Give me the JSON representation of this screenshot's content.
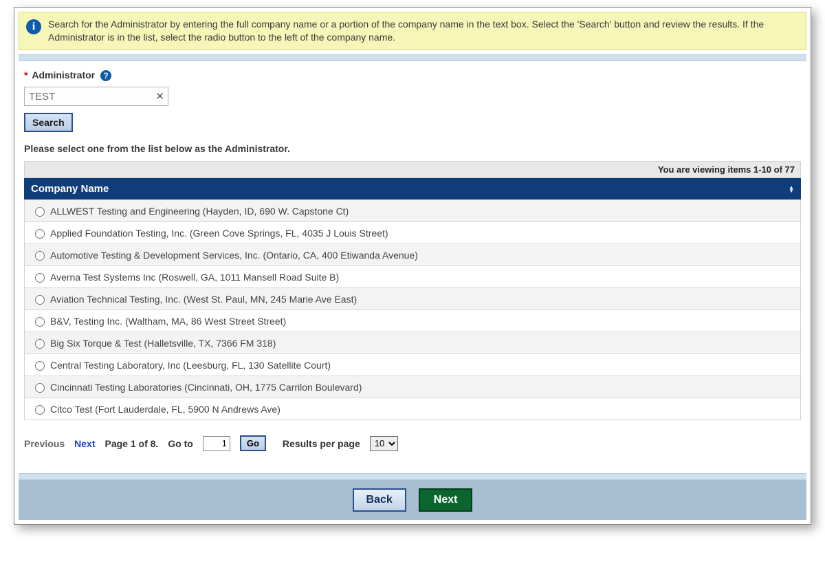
{
  "banner": {
    "text": "Search for the Administrator by entering the full company name or a portion of the company name in the text box. Select the 'Search' button and review the results. If the Administrator is in the list, select the radio button to the left of the company name."
  },
  "field": {
    "label": "Administrator",
    "value": "TEST",
    "search_label": "Search"
  },
  "instruction": "Please select one from the list below as the Administrator.",
  "count_text": "You are viewing items 1-10 of 77",
  "table": {
    "header": "Company Name",
    "rows": [
      "ALLWEST Testing and Engineering (Hayden, ID, 690 W. Capstone Ct)",
      "Applied Foundation Testing, Inc. (Green Cove Springs, FL, 4035 J Louis Street)",
      "Automotive Testing & Development Services, Inc. (Ontario, CA, 400 Etiwanda Avenue)",
      "Averna Test Systems Inc (Roswell, GA, 1011 Mansell Road Suite B)",
      "Aviation Technical Testing, Inc. (West St. Paul, MN, 245 Marie Ave East)",
      "B&V, Testing Inc. (Waltham, MA, 86 West Street Street)",
      "Big Six Torque & Test (Halletsville, TX, 7366 FM 318)",
      "Central Testing Laboratory, Inc (Leesburg, FL, 130 Satellite Court)",
      "Cincinnati Testing Laboratories (Cincinnati, OH, 1775 Carrilon Boulevard)",
      "Citco Test (Fort Lauderdale, FL, 5900 N Andrews Ave)"
    ]
  },
  "pager": {
    "previous": "Previous",
    "next": "Next",
    "page_text": "Page 1 of 8.",
    "goto_label": "Go to",
    "goto_value": "1",
    "go_label": "Go",
    "rpp_label": "Results per page",
    "rpp_value": "10"
  },
  "buttons": {
    "back": "Back",
    "next": "Next"
  }
}
